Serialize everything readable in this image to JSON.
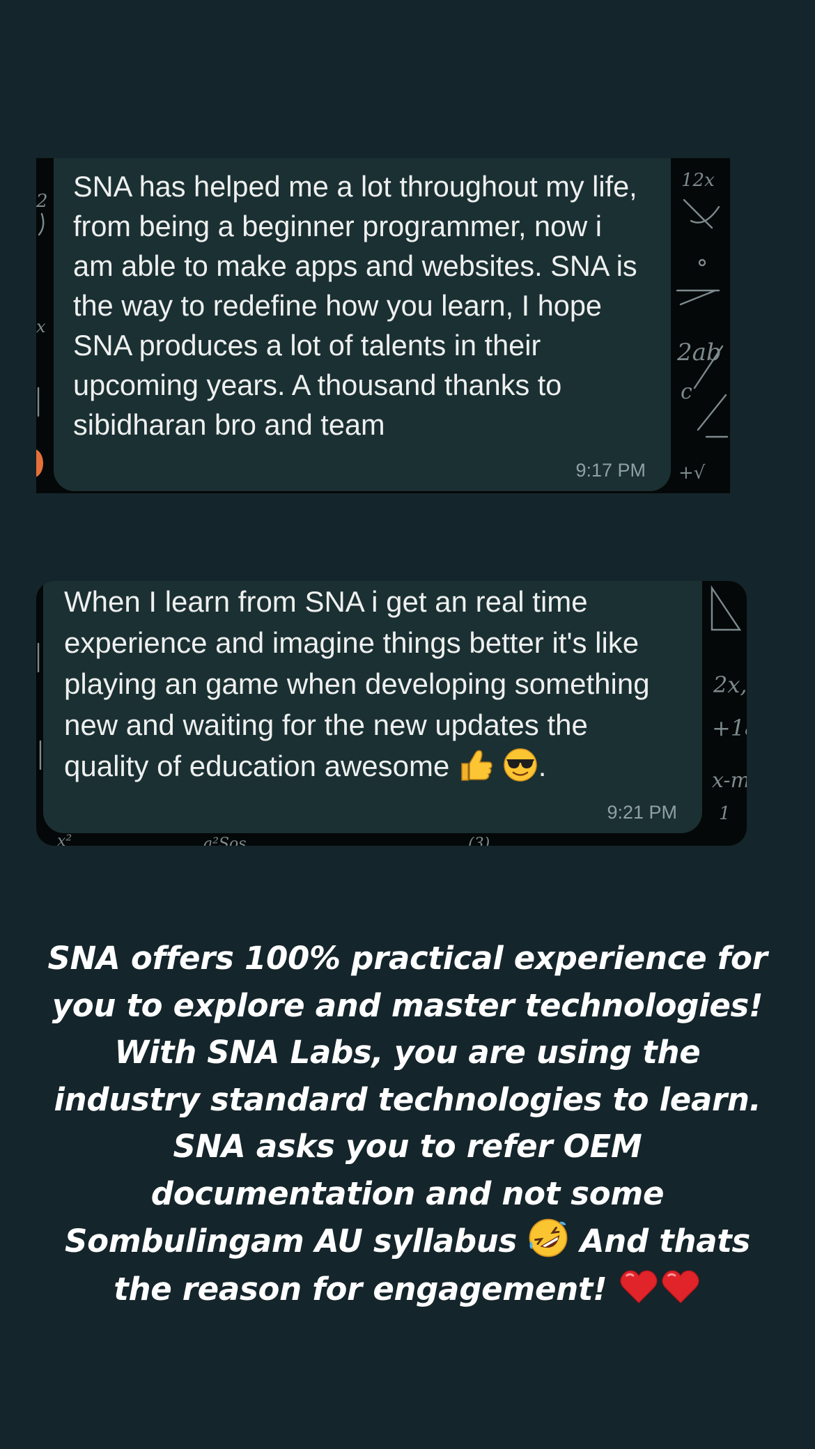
{
  "testimonials": [
    {
      "text": "SNA has helped me a lot throughout my life, from being a beginner programmer, now i am able to make apps and websites. SNA is the way to redefine how you learn, I hope SNA produces a lot of talents in their upcoming years. A thousand thanks to sibidharan bro and team",
      "time": "9:17 PM"
    },
    {
      "text": "When I learn from SNA i get an real time experience and imagine things better it's like playing an game when developing something new and waiting for the new updates the quality of education awesome",
      "emojis": [
        "thumbs-up-icon",
        "sunglasses-face-icon"
      ],
      "trailing": ".",
      "time": "9:21 PM"
    }
  ],
  "caption": {
    "part1": "SNA offers 100% practical experience for you to explore and master technologies! With SNA Labs, you are using the industry standard technologies to learn. SNA asks you to refer OEM documentation and not some Sombulingam AU syllabus",
    "emoji1": "rolling-laughing-face-icon",
    "part2": "And thats the reason for engagement!",
    "emojis_end": [
      "red-heart-icon",
      "red-heart-icon"
    ]
  },
  "colors": {
    "background": "#14252b",
    "bubble": "#1b3033",
    "text": "#eef0ef",
    "timestamp": "#8fa1a3",
    "caption": "#ffffff"
  }
}
